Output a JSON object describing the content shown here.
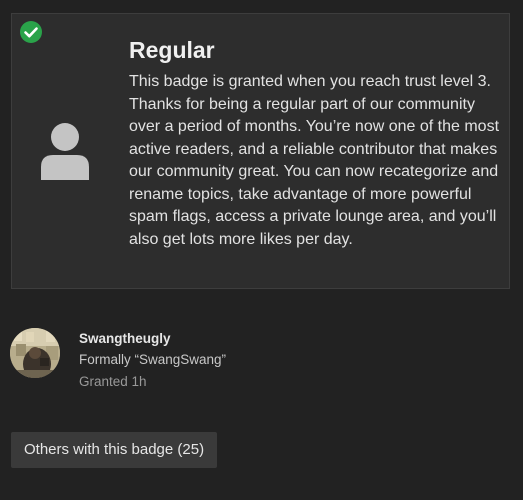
{
  "badge": {
    "title": "Regular",
    "description": "This badge is granted when you reach trust level 3. Thanks for being a regular part of our community over a period of months. You’re now one of the most active readers, and a reliable contributor that makes our community great. You can now recategorize and rename topics, take advantage of more powerful spam flags, access a private lounge area, and you’ll also get lots more likes per day.",
    "granted_icon": "check-circle-icon",
    "badge_icon": "user-icon"
  },
  "grantee": {
    "username": "Swangtheugly",
    "formal_name": "Formally “SwangSwang”",
    "granted_text": "Granted 1h"
  },
  "others_button": {
    "label": "Others with this badge (25)"
  },
  "colors": {
    "background": "#222222",
    "card": "#2d2d2d",
    "check_green": "#2aa34a",
    "icon_gray": "#c4c4c4",
    "button": "#3a3a3a"
  }
}
